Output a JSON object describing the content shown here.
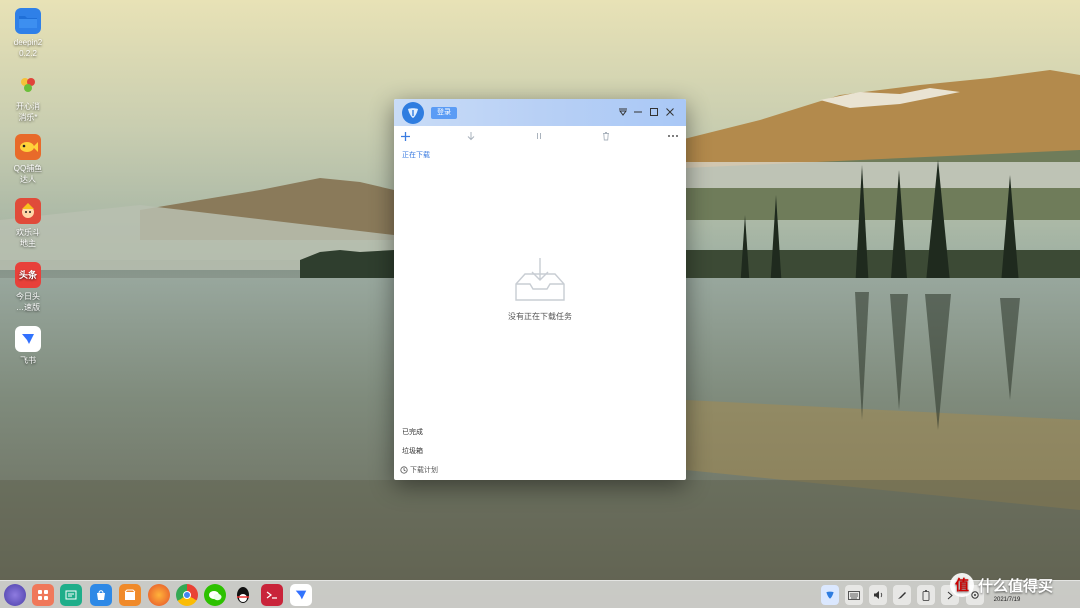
{
  "desktop": {
    "icons": [
      {
        "label": "deepin2\n0.2.2",
        "icon": "folder-icon",
        "color": "#2f80e8"
      },
      {
        "label": "开心消\n消乐*",
        "icon": "happy-match-icon",
        "color": "#f0a030"
      },
      {
        "label": "QQ捕鱼\n达人",
        "icon": "qq-fishing-icon",
        "color": "#e86a2a"
      },
      {
        "label": "欢乐斗\n地主",
        "icon": "landlord-game-icon",
        "color": "#e04b3a"
      },
      {
        "label": "今日头\n…速版",
        "icon": "toutiao-icon",
        "color": "#e8403a",
        "glyph": "头条"
      },
      {
        "label": "飞书",
        "icon": "feishu-icon",
        "color": "#ffffff"
      }
    ]
  },
  "window": {
    "login_label": "登录",
    "tab_downloading": "正在下载",
    "empty_text": "没有正在下载任务",
    "sidebar": {
      "completed": "已完成",
      "trash": "垃圾箱",
      "download_plan": "下载计划"
    },
    "accent": "#3a7be0"
  },
  "dock": {
    "apps": [
      "launcher-icon",
      "apps-grid-icon",
      "file-manager-icon",
      "store-icon",
      "app-store-icon",
      "firefox-icon",
      "chrome-icon",
      "wechat-icon",
      "qq-icon",
      "terminal-icon",
      "feishu-icon"
    ],
    "tray": [
      "downloader-tray-icon",
      "keyboard-icon",
      "volume-icon",
      "pen-icon",
      "battery-icon",
      "chevron-right-icon",
      "settings-icon"
    ],
    "clock_date": "2021/7/19"
  },
  "watermark": "什么值得买"
}
